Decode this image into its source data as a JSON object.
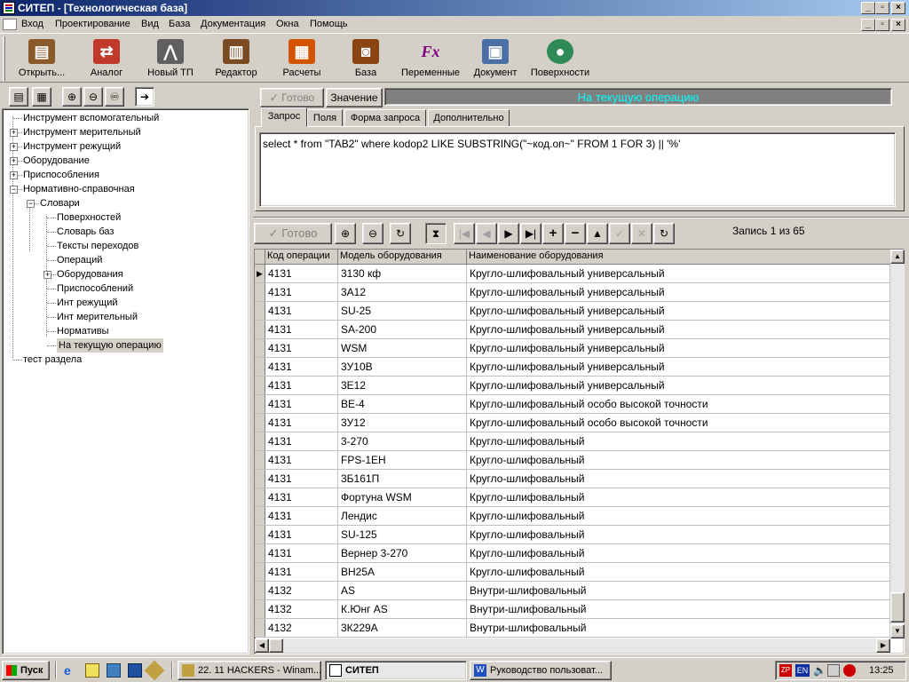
{
  "window": {
    "title": "СИТЕП - [Технологическая база]"
  },
  "menu": [
    "Вход",
    "Проектирование",
    "Вид",
    "База",
    "Документация",
    "Окна",
    "Помощь"
  ],
  "toolbar": [
    {
      "label": "Открыть...",
      "icon": "open-icon",
      "color": "#8b5a2b"
    },
    {
      "label": "Аналог",
      "icon": "analog-icon",
      "color": "#c0392b"
    },
    {
      "label": "Новый ТП",
      "icon": "compass-icon",
      "color": "#606060"
    },
    {
      "label": "Редактор",
      "icon": "editor-icon",
      "color": "#7a4a20"
    },
    {
      "label": "Расчеты",
      "icon": "calculator-icon",
      "color": "#d35400"
    },
    {
      "label": "База",
      "icon": "database-icon",
      "color": "#8b4513"
    },
    {
      "label": "Переменные",
      "icon": "function-icon",
      "color": "#800080"
    },
    {
      "label": "Документ",
      "icon": "document-icon",
      "color": "#4a6fa5"
    },
    {
      "label": "Поверхности",
      "icon": "surface-icon",
      "color": "#2e8b57"
    }
  ],
  "tree": [
    {
      "label": "Инструмент вспомогательный",
      "level": 0,
      "expander": ""
    },
    {
      "label": "Инструмент мерительный",
      "level": 0,
      "expander": "+"
    },
    {
      "label": "Инструмент режущий",
      "level": 0,
      "expander": "+"
    },
    {
      "label": "Оборудование",
      "level": 0,
      "expander": "+"
    },
    {
      "label": "Приспособления",
      "level": 0,
      "expander": "+"
    },
    {
      "label": "Нормативно-справочная",
      "level": 0,
      "expander": "−"
    },
    {
      "label": "Словари",
      "level": 1,
      "expander": "−"
    },
    {
      "label": "Поверхностей",
      "level": 2,
      "expander": ""
    },
    {
      "label": "Словарь баз",
      "level": 2,
      "expander": ""
    },
    {
      "label": "Тексты переходов",
      "level": 2,
      "expander": ""
    },
    {
      "label": "Операций",
      "level": 2,
      "expander": ""
    },
    {
      "label": "Оборудования",
      "level": 2,
      "expander": "+"
    },
    {
      "label": "Приспособлений",
      "level": 2,
      "expander": ""
    },
    {
      "label": "Инт режущий",
      "level": 2,
      "expander": ""
    },
    {
      "label": "Инт мерительный",
      "level": 2,
      "expander": ""
    },
    {
      "label": "Нормативы",
      "level": 2,
      "expander": ""
    },
    {
      "label": "На текущую операцию",
      "level": 2,
      "expander": "",
      "selected": true
    },
    {
      "label": "тест раздела",
      "level": 0,
      "expander": ""
    }
  ],
  "query": {
    "ready_label": "Готово",
    "value_label": "Значение",
    "banner": "На текущую операцию",
    "tabs": [
      "Запрос",
      "Поля",
      "Форма запроса",
      "Дополнительно"
    ],
    "sql": "select * from \"TAB2\" where kodop2  LIKE SUBSTRING(\"~код.оп~\" FROM 1 FOR 3)  || '%'"
  },
  "nav": {
    "ready_label": "Готово",
    "record_text": "Запись 1 из 65"
  },
  "grid": {
    "columns": [
      "Код операции",
      "Модель оборудования",
      "Наименование оборудования"
    ],
    "rows": [
      [
        "4131",
        "3130   кф",
        "Кругло-шлифовальный универсальный"
      ],
      [
        "4131",
        "3А12",
        "Кругло-шлифовальный универсальный"
      ],
      [
        "4131",
        "SU-25",
        "Кругло-шлифовальный универсальный"
      ],
      [
        "4131",
        "SA-200",
        "Кругло-шлифовальный универсальный"
      ],
      [
        "4131",
        "WSM",
        "Кругло-шлифовальный универсальный"
      ],
      [
        "4131",
        "3У10В",
        "Кругло-шлифовальный универсальный"
      ],
      [
        "4131",
        "3Е12",
        "Кругло-шлифовальный универсальный"
      ],
      [
        "4131",
        "BE-4",
        "Кругло-шлифовальный особо высокой точности"
      ],
      [
        "4131",
        "3У12",
        "Кругло-шлифовальный особо высокой точности"
      ],
      [
        "4131",
        "3-270",
        "Кругло-шлифовальный"
      ],
      [
        "4131",
        "FPS-1EH",
        "Кругло-шлифовальный"
      ],
      [
        "4131",
        "3Б161П",
        "Кругло-шлифовальный"
      ],
      [
        "4131",
        "Фортуна WSM",
        "Кругло-шлифовальный"
      ],
      [
        "4131",
        "Лендис",
        "Кругло-шлифовальный"
      ],
      [
        "4131",
        "SU-125",
        "Кругло-шлифовальный"
      ],
      [
        "4131",
        "Вернер 3-270",
        "Кругло-шлифовальный"
      ],
      [
        "4131",
        "ВН25А",
        "Кругло-шлифовальный"
      ],
      [
        "4132",
        "AS",
        "Внутри-шлифовальный"
      ],
      [
        "4132",
        "К.Юнг AS",
        "Внутри-шлифовальный"
      ],
      [
        "4132",
        "3К229А",
        "Внутри-шлифовальный"
      ]
    ]
  },
  "taskbar": {
    "start": "Пуск",
    "tasks": [
      "22. 11 HACKERS - Winam...",
      "СИТЕП",
      "Руководство пользоват..."
    ],
    "lang": "EN",
    "clock": "13:25"
  }
}
